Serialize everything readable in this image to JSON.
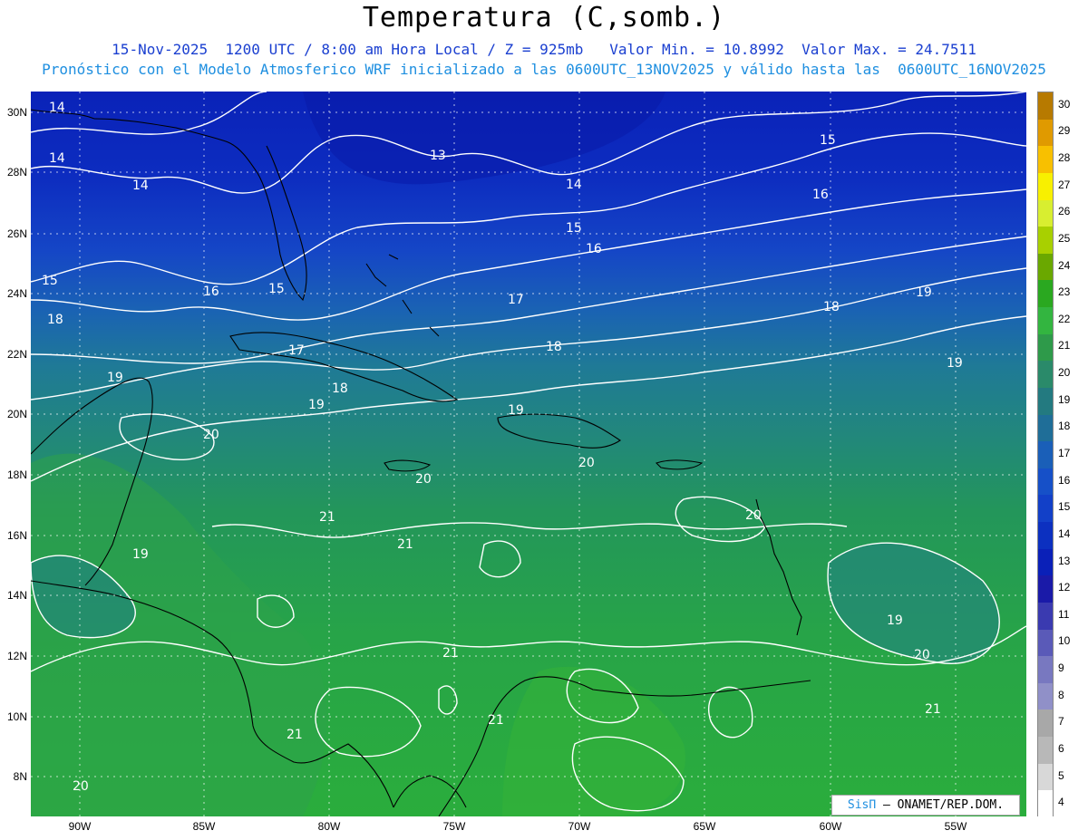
{
  "title": "Temperatura (C,somb.)",
  "subtitle1": "15-Nov-2025  1200 UTC / 8:00 am Hora Local / Z = 925mb   Valor Min. = 10.8992  Valor Max. = 24.7511",
  "subtitle2": "Pronóstico con el Modelo Atmosferico WRF inicializado a las 0600UTC_13NOV2025 y válido hasta las  0600UTC_16NOV2025",
  "credit": {
    "brand": "SisΠ",
    "text": "– ONAMET/REP.DOM."
  },
  "lat_labels": [
    "30N",
    "28N",
    "26N",
    "24N",
    "22N",
    "20N",
    "18N",
    "16N",
    "14N",
    "12N",
    "10N",
    "8N"
  ],
  "lon_labels": [
    "90W",
    "85W",
    "80W",
    "75W",
    "70W",
    "65W",
    "60W",
    "55W"
  ],
  "colorbar": {
    "labels": [
      "30",
      "29",
      "28",
      "27",
      "26",
      "25",
      "24",
      "23",
      "22",
      "21",
      "20",
      "19",
      "18",
      "17",
      "16",
      "15",
      "14",
      "13",
      "12",
      "11",
      "10",
      "9",
      "8",
      "7",
      "6",
      "5",
      "4"
    ],
    "colors": [
      "#b77a00",
      "#e09a00",
      "#f8c000",
      "#f8f000",
      "#d8ee30",
      "#a8d000",
      "#6aa800",
      "#2aa820",
      "#33b540",
      "#2e9a4a",
      "#2a8a6a",
      "#237a80",
      "#1f6e98",
      "#1a5fb8",
      "#1650c8",
      "#1240c8",
      "#0c30c0",
      "#0a20b8",
      "#1a1aa8",
      "#3a3ab0",
      "#5a5ab8",
      "#7878c0",
      "#9090c8",
      "#a8a8a8",
      "#b8b8b8",
      "#d8d8d8",
      "#ffffff"
    ]
  },
  "contour_labels": [
    {
      "text": "14"
    },
    {
      "text": "14"
    },
    {
      "text": "14"
    },
    {
      "text": "13"
    },
    {
      "text": "14"
    },
    {
      "text": "15"
    },
    {
      "text": "16"
    },
    {
      "text": "15"
    },
    {
      "text": "15"
    },
    {
      "text": "16"
    },
    {
      "text": "15"
    },
    {
      "text": "16"
    },
    {
      "text": "17"
    },
    {
      "text": "18"
    },
    {
      "text": "18"
    },
    {
      "text": "17"
    },
    {
      "text": "18"
    },
    {
      "text": "18"
    },
    {
      "text": "19"
    },
    {
      "text": "19"
    },
    {
      "text": "19"
    },
    {
      "text": "19"
    },
    {
      "text": "19"
    },
    {
      "text": "20"
    },
    {
      "text": "20"
    },
    {
      "text": "20"
    },
    {
      "text": "20"
    },
    {
      "text": "21"
    },
    {
      "text": "21"
    },
    {
      "text": "19"
    },
    {
      "text": "19"
    },
    {
      "text": "21"
    },
    {
      "text": "20"
    },
    {
      "text": "21"
    },
    {
      "text": "21"
    },
    {
      "text": "21"
    },
    {
      "text": "20"
    }
  ]
}
